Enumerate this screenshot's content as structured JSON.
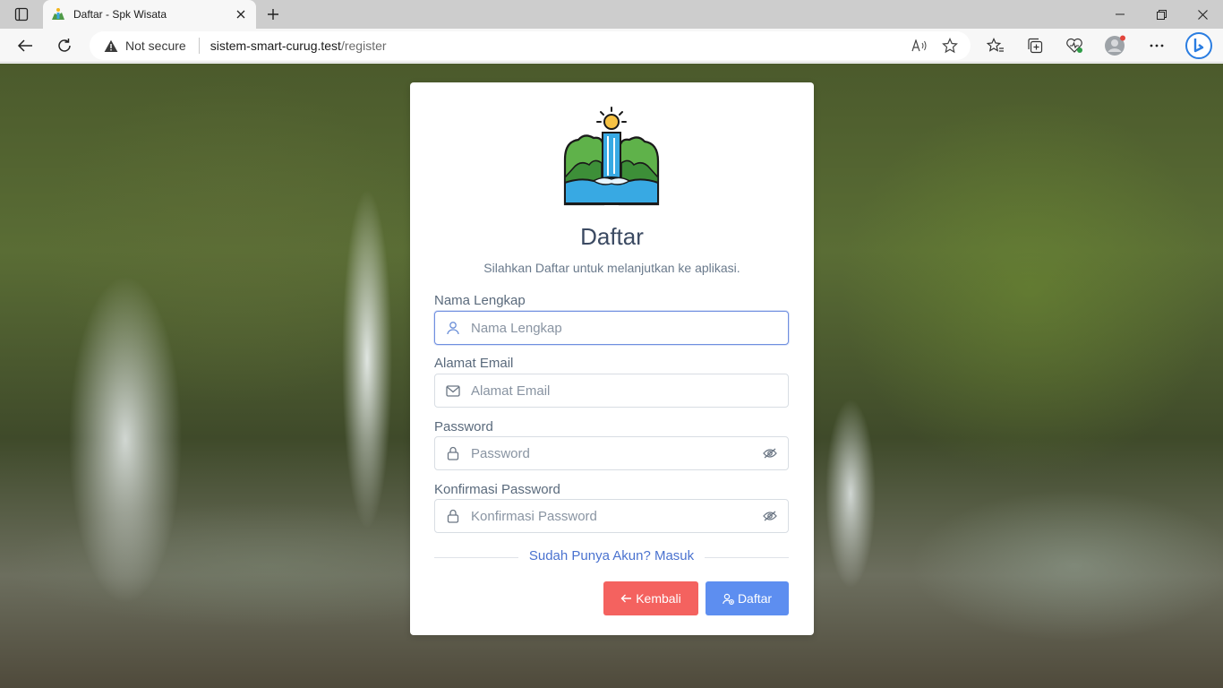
{
  "browser": {
    "tab_title": "Daftar - Spk Wisata",
    "security_label": "Not secure",
    "url_host": "sistem-smart-curug.test",
    "url_path": "/register"
  },
  "form": {
    "title": "Daftar",
    "subtitle": "Silahkan Daftar untuk melanjutkan ke aplikasi.",
    "fields": [
      {
        "label": "Nama Lengkap",
        "placeholder": "Nama Lengkap",
        "icon": "user-icon"
      },
      {
        "label": "Alamat Email",
        "placeholder": "Alamat Email",
        "icon": "mail-icon"
      },
      {
        "label": "Password",
        "placeholder": "Password",
        "icon": "lock-icon"
      },
      {
        "label": "Konfirmasi Password",
        "placeholder": "Konfirmasi Password",
        "icon": "lock-icon"
      }
    ],
    "login_link": "Sudah Punya Akun? Masuk",
    "back_button": "Kembali",
    "submit_button": "Daftar"
  },
  "colors": {
    "back_button": "#f4625f",
    "submit_button": "#5d8ef0",
    "link": "#4a72cf"
  }
}
